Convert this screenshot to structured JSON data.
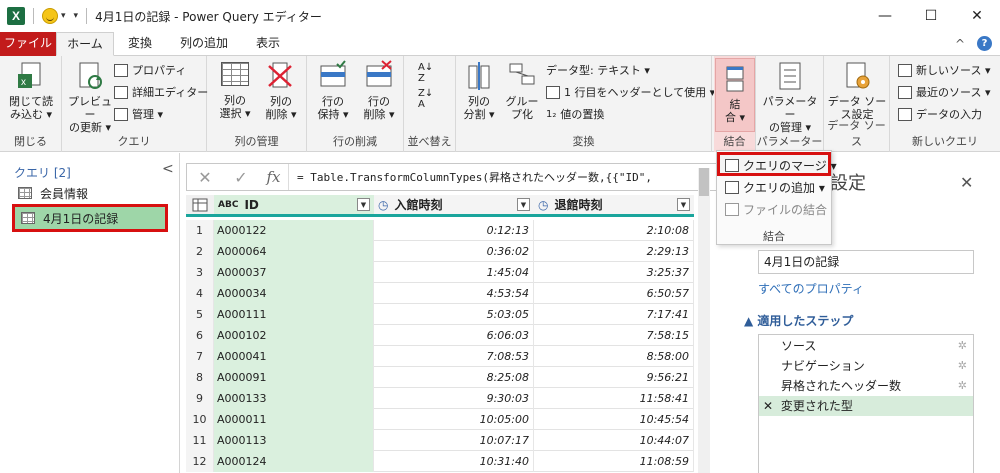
{
  "window": {
    "title": "4月1日の記録 - Power Query エディター",
    "app_icon": "X",
    "qat_dropdown": "▾",
    "controls": {
      "minimize": "—",
      "maximize": "☐",
      "close": "✕"
    }
  },
  "tabs": [
    {
      "label": "ファイル"
    },
    {
      "label": "ホーム"
    },
    {
      "label": "変換"
    },
    {
      "label": "列の追加"
    },
    {
      "label": "表示"
    }
  ],
  "tab_right": {
    "collapse": "^",
    "help": "?"
  },
  "ribbon": {
    "close_group": {
      "button": "閉じて読\nみ込む ▾",
      "label": "閉じる"
    },
    "query_group": {
      "preview": "プレビュー\nの更新 ▾",
      "properties": "プロパティ",
      "advanced": "詳細エディター",
      "manage": "管理 ▾",
      "label": "クエリ"
    },
    "manage_cols": {
      "select": "列の\n選択 ▾",
      "remove": "列の\n削除 ▾",
      "label": "列の管理"
    },
    "reduce_rows": {
      "keep": "行の\n保持 ▾",
      "remove": "行の\n削除 ▾",
      "label": "行の削減"
    },
    "sort": {
      "label": "並べ替え"
    },
    "transform": {
      "split": "列の\n分割 ▾",
      "group": "グルー\nプ化",
      "datatype": "データ型: テキスト ▾",
      "header": "1 行目をヘッダーとして使用 ▾",
      "replace": "値の置換",
      "label": "変換"
    },
    "combine": {
      "button": "結\n合 ▾",
      "label": "結合"
    },
    "params": {
      "button": "パラメーター\nの管理 ▾",
      "label": "パラメーター"
    },
    "datasource": {
      "button": "データ ソー\nス設定",
      "label": "データ ソース"
    },
    "newquery": {
      "new_source": "新しいソース ▾",
      "recent": "最近のソース ▾",
      "enter": "データの入力",
      "label": "新しいクエリ"
    }
  },
  "queries": {
    "header": "クエリ [2]",
    "collapse": "<",
    "items": [
      {
        "label": "会員情報"
      },
      {
        "label": "4月1日の記録"
      }
    ]
  },
  "formula": {
    "cancel": "✕",
    "commit": "✓",
    "fx": "fx",
    "text": "= Table.TransformColumnTypes(昇格されたヘッダー数,{{\"ID\","
  },
  "grid": {
    "columns": [
      {
        "type_icon": "ABC",
        "name": "ID"
      },
      {
        "type_icon": "clock",
        "name": "入館時刻"
      },
      {
        "type_icon": "clock",
        "name": "退館時刻"
      }
    ],
    "rows": [
      {
        "n": "1",
        "id": "A000122",
        "in": "0:12:13",
        "out": "2:10:08"
      },
      {
        "n": "2",
        "id": "A000064",
        "in": "0:36:02",
        "out": "2:29:13"
      },
      {
        "n": "3",
        "id": "A000037",
        "in": "1:45:04",
        "out": "3:25:37"
      },
      {
        "n": "4",
        "id": "A000034",
        "in": "4:53:54",
        "out": "6:50:57"
      },
      {
        "n": "5",
        "id": "A000111",
        "in": "5:03:05",
        "out": "7:17:41"
      },
      {
        "n": "6",
        "id": "A000102",
        "in": "6:06:03",
        "out": "7:58:15"
      },
      {
        "n": "7",
        "id": "A000041",
        "in": "7:08:53",
        "out": "8:58:00"
      },
      {
        "n": "8",
        "id": "A000091",
        "in": "8:25:08",
        "out": "9:56:21"
      },
      {
        "n": "9",
        "id": "A000133",
        "in": "9:30:03",
        "out": "11:58:41"
      },
      {
        "n": "10",
        "id": "A000011",
        "in": "10:05:00",
        "out": "10:45:54"
      },
      {
        "n": "11",
        "id": "A000113",
        "in": "10:07:17",
        "out": "10:44:07"
      },
      {
        "n": "12",
        "id": "A000124",
        "in": "10:31:40",
        "out": "11:08:59"
      }
    ]
  },
  "merge_menu": {
    "merge_queries": "クエリのマージ ▾",
    "append_queries": "クエリの追加 ▾",
    "combine_files": "ファイルの結合",
    "label": "結合"
  },
  "settings": {
    "title": "設定",
    "close": "✕",
    "name_value": "4月1日の記録",
    "all_props": "すべてのプロパティ",
    "steps_header": "▲ 適用したステップ",
    "steps": [
      {
        "label": "ソース"
      },
      {
        "label": "ナビゲーション"
      },
      {
        "label": "昇格されたヘッダー数"
      },
      {
        "label": "変更された型",
        "prefix": "✕"
      }
    ]
  }
}
